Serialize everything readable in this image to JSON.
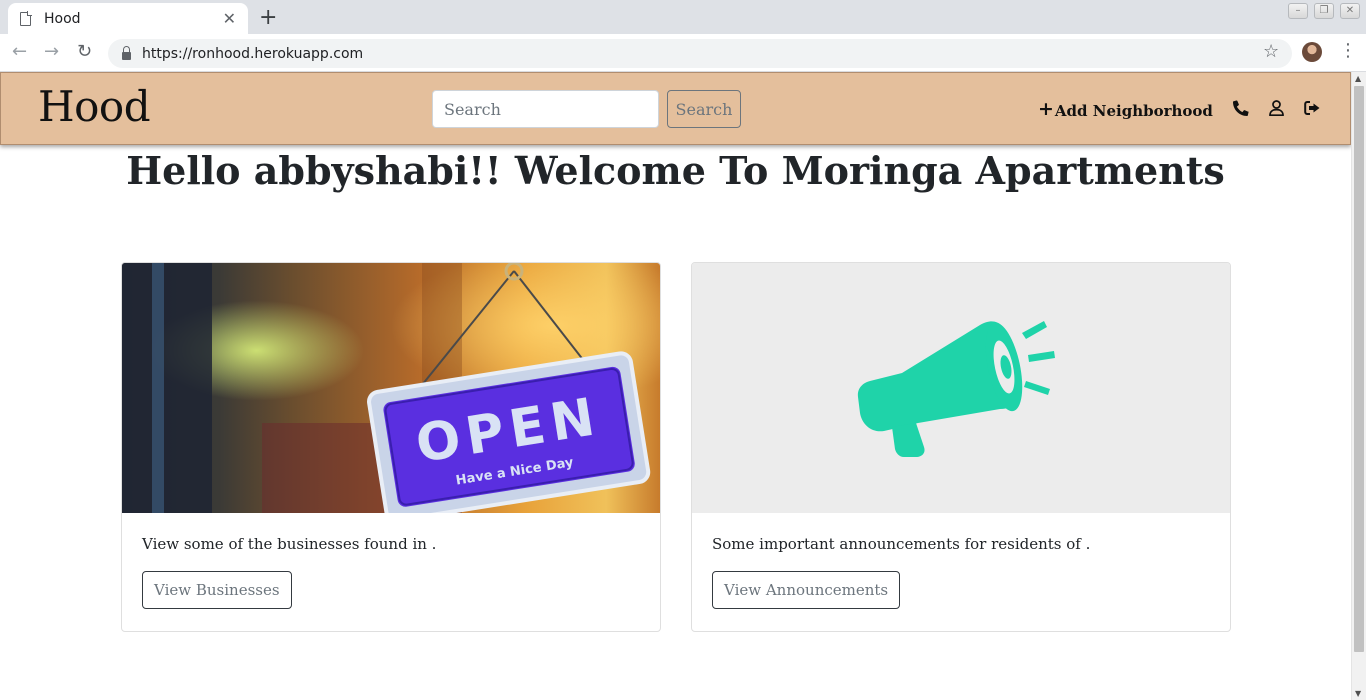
{
  "browser": {
    "tab_title": "Hood",
    "tab_close": "✕",
    "new_tab": "+",
    "url": "https://ronhood.herokuapp.com",
    "back": "←",
    "forward": "→",
    "reload": "↻",
    "bookmark": "☆",
    "menu": "⋮"
  },
  "navbar": {
    "brand": "Hood",
    "search_placeholder": "Search",
    "search_button": "Search",
    "add_neighborhood_icon": "+",
    "add_neighborhood": "Add Neighborhood",
    "icons": [
      "phone-icon",
      "user-icon",
      "sign-out-icon"
    ]
  },
  "welcome": "Hello abbyshabi!! Welcome To Moringa Apartments",
  "cards": [
    {
      "image_text": "OPEN",
      "image_subtext": "Have a Nice Day",
      "text": "View some of the businesses found in .",
      "button": "View Businesses"
    },
    {
      "image": "megaphone-icon",
      "accent": "#1fd3a9",
      "text": "Some important announcements for residents of .",
      "button": "View Announcements"
    }
  ],
  "colors": {
    "navbar_bg": "#e4bf9c",
    "sign_bg": "#5a2fe0"
  }
}
